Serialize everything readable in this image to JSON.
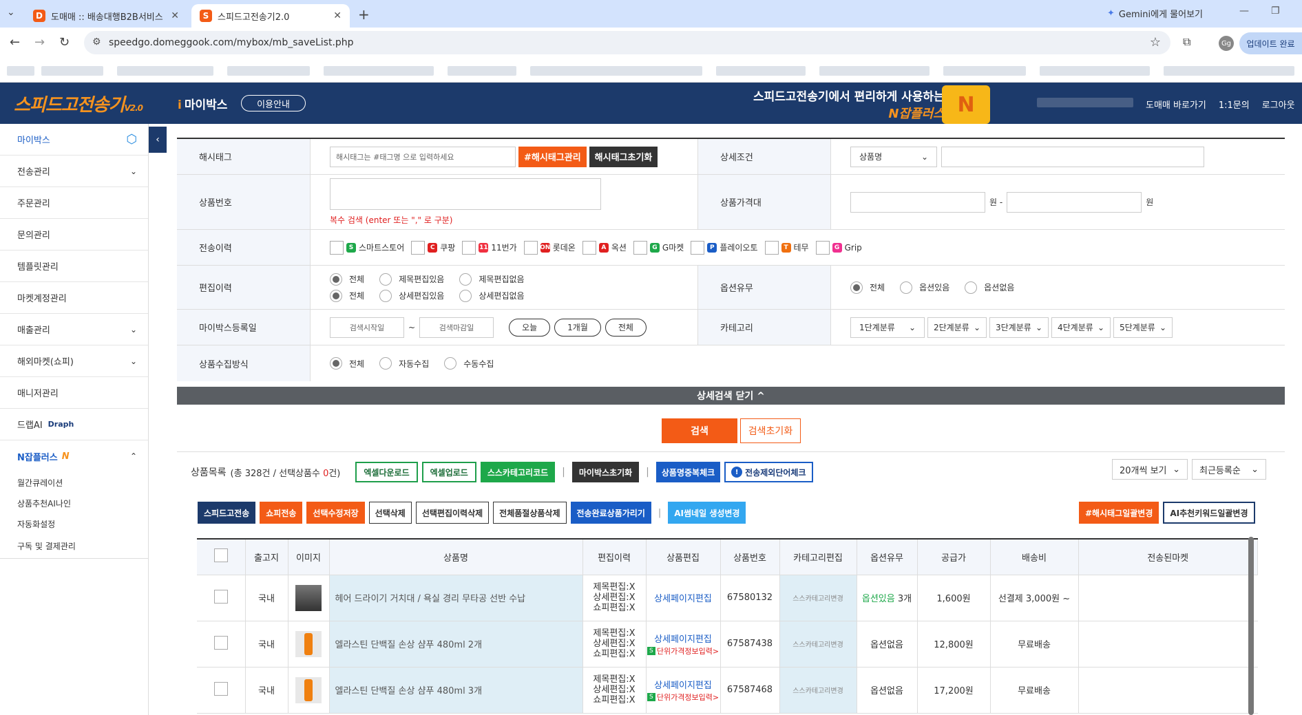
{
  "browser": {
    "tabs": [
      {
        "title": "도매매 :: 배송대행B2B서비스",
        "active": false
      },
      {
        "title": "스피드고전송기2.0",
        "active": true
      }
    ],
    "gemini": "Gemini에게 물어보기",
    "url": "speedgo.domeggook.com/mybox/mb_saveList.php",
    "avatar": "Gg",
    "update": "업데이트 완료"
  },
  "header": {
    "logo": "스피드고전송기",
    "logo_version": "V2.0",
    "section": "마이박스",
    "guide": "이용안내",
    "promo_line1": "스피드고전송기에서 편리하게 사용하는",
    "promo_line2": "N잡플러스",
    "links": [
      "도매매 바로가기",
      "1:1문의",
      "로그아웃"
    ]
  },
  "sidebar": {
    "items": [
      {
        "label": "마이박스",
        "active": true
      },
      {
        "label": "전송관리",
        "chev": true
      },
      {
        "label": "주문관리"
      },
      {
        "label": "문의관리"
      },
      {
        "label": "템플릿관리"
      },
      {
        "label": "마켓계정관리"
      },
      {
        "label": "매출관리",
        "chev": true
      },
      {
        "label": "해외마켓(쇼피)",
        "chev": true
      },
      {
        "label": "매니저관리"
      },
      {
        "label": "드랩AI",
        "badge": "Draph"
      },
      {
        "label": "N잡플러스",
        "chev_up": true
      }
    ],
    "sub_items": [
      "월간큐레이션",
      "상품추천AI나인",
      "자동화설정",
      "구독 및 결제관리"
    ]
  },
  "form": {
    "hashtag_label": "해시태그",
    "hashtag_placeholder": "해시태그는 #태그명 으로 입력하세요",
    "hashtag_manage": "#해시태그관리",
    "hashtag_reset": "해시태그초기화",
    "detail_label": "상세조건",
    "detail_select": "상품명",
    "prodno_label": "상품번호",
    "prodno_hint": "복수 검색 (enter 또는 \",\" 로 구분)",
    "price_label": "상품가격대",
    "won": "원",
    "won_dash": "원 -",
    "history_label": "전송이력",
    "markets": [
      {
        "name": "스마트스토어",
        "color": "#1ea84a",
        "ic": "S"
      },
      {
        "name": "쿠팡",
        "color": "#e02020",
        "ic": "C"
      },
      {
        "name": "11번가",
        "color": "#f03040",
        "ic": "11"
      },
      {
        "name": "롯데온",
        "color": "#e02020",
        "ic": "ON"
      },
      {
        "name": "옥션",
        "color": "#e02020",
        "ic": "A"
      },
      {
        "name": "G마켓",
        "color": "#1ea84a",
        "ic": "G"
      },
      {
        "name": "플레이오토",
        "color": "#1a5dc6",
        "ic": "P"
      },
      {
        "name": "테무",
        "color": "#f07010",
        "ic": "T"
      },
      {
        "name": "Grip",
        "color": "#f03090",
        "ic": "G"
      }
    ],
    "edit_label": "편집이력",
    "edit_row1": [
      "전체",
      "제목편집있음",
      "제목편집없음"
    ],
    "edit_row2": [
      "전체",
      "상세편집있음",
      "상세편집없음"
    ],
    "option_label": "옵션유무",
    "option_values": [
      "전체",
      "옵션있음",
      "옵션없음"
    ],
    "regdate_label": "마이박스등록일",
    "start_placeholder": "검색시작일",
    "tilde": "~",
    "end_placeholder": "검색마감일",
    "date_btns": [
      "오늘",
      "1개월",
      "전체"
    ],
    "category_label": "카테고리",
    "categories": [
      "1단계분류",
      "2단계분류",
      "3단계분류",
      "4단계분류",
      "5단계분류"
    ],
    "collect_label": "상품수집방식",
    "collect_values": [
      "전체",
      "자동수집",
      "수동수집"
    ],
    "close_detail": "상세검색 닫기 ^",
    "search": "검색",
    "search_reset": "검색초기화"
  },
  "list": {
    "title": "상품목록",
    "count_prefix": "(총 328건 / 선택상품수",
    "selected": "0",
    "count_suffix": "건)",
    "excel_down": "엑셀다운로드",
    "excel_up": "엑셀업로드",
    "ss_cat": "스스카테고리코드",
    "mybox_reset": "마이박스초기화",
    "dup_check": "상품명중복체크",
    "exclude_check": "전송제외단어체크",
    "per_page": "20개씩 보기",
    "sort": "최근등록순",
    "actions": [
      {
        "label": "스피드고전송",
        "style": "navy"
      },
      {
        "label": "쇼피전송",
        "style": "org"
      },
      {
        "label": "선택수정저장",
        "style": "org"
      },
      {
        "label": "선택삭제",
        "style": ""
      },
      {
        "label": "선택편집이력삭제",
        "style": ""
      },
      {
        "label": "전체품절상품삭제",
        "style": ""
      },
      {
        "label": "전송완료상품가리기",
        "style": "blu"
      },
      {
        "label": "AI썸네일 생성변경",
        "style": "sky"
      }
    ],
    "hashtag_bulk": "#해시태그일괄변경",
    "ai_keyword": "AI추천키워드일괄변경",
    "columns": [
      "",
      "출고지",
      "이미지",
      "상품명",
      "편집이력",
      "상품편집",
      "상품번호",
      "카테고리편집",
      "옵션유무",
      "공급가",
      "배송비",
      "전송된마켓"
    ],
    "rows": [
      {
        "origin": "국내",
        "name": "헤어 드라이기 거치대 / 욕실 경리 무타공 선반 수납",
        "hist": [
          "제목편집:X",
          "상세편집:X",
          "쇼피편집:X"
        ],
        "edit": "상세페이지편집",
        "unit": "",
        "no": "67580132",
        "cat": "스스카테고리변경",
        "opt": "옵션있음",
        "opt_cnt": "3개",
        "price": "1,600원",
        "ship": "선결제  3,000원 ~",
        "img": "shelf"
      },
      {
        "origin": "국내",
        "name": "엘라스틴 단백질 손상 샴푸 480ml 2개",
        "hist": [
          "제목편집:X",
          "상세편집:X",
          "쇼피편집:X"
        ],
        "edit": "상세페이지편집",
        "unit": "단위가격정보입력>",
        "no": "67587438",
        "cat": "스스카테고리변경",
        "opt": "옵션없음",
        "opt_cnt": "",
        "price": "12,800원",
        "ship": "무료배송",
        "img": "bottle"
      },
      {
        "origin": "국내",
        "name": "엘라스틴 단백질 손상 샴푸 480ml 3개",
        "hist": [
          "제목편집:X",
          "상세편집:X",
          "쇼피편집:X"
        ],
        "edit": "상세페이지편집",
        "unit": "단위가격정보입력>",
        "no": "67587468",
        "cat": "스스카테고리변경",
        "opt": "옵션없음",
        "opt_cnt": "",
        "price": "17,200원",
        "ship": "무료배송",
        "img": "bottle"
      }
    ]
  }
}
